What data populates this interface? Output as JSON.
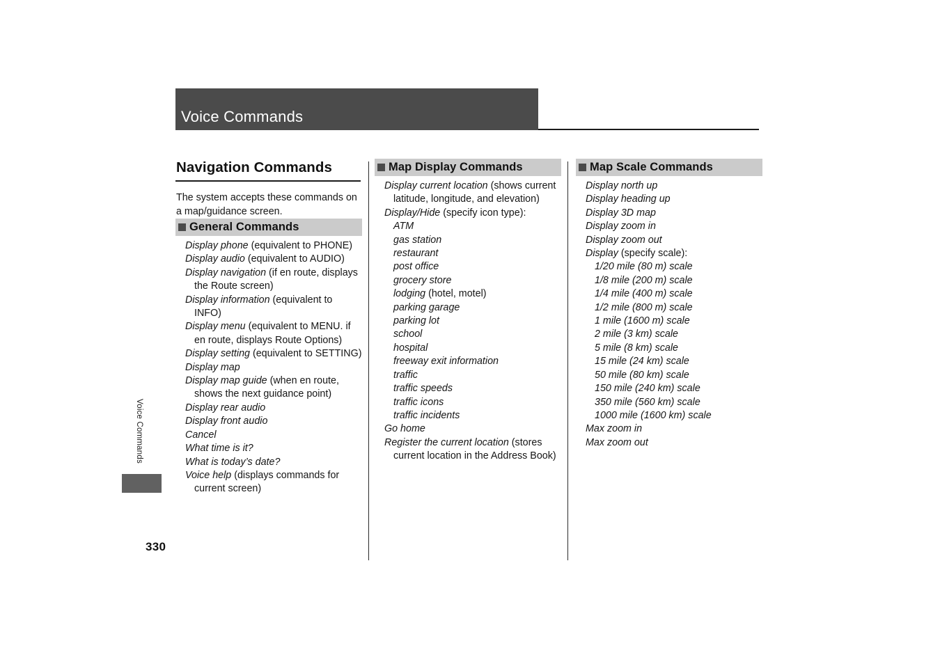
{
  "header": {
    "title": "Voice Commands",
    "bar_color": "#4b4b4b"
  },
  "side_tab": {
    "label": "Voice Commands",
    "block_color": "#616161"
  },
  "page_number": "330",
  "columns": {
    "left": {
      "title": "Navigation Commands",
      "intro": "The system accepts these commands on a map/guidance screen.",
      "section": {
        "label": "General Commands",
        "bullet_color": "#4b4b4b",
        "band_color": "#cbcbcb"
      },
      "items": [
        {
          "italic": "Display phone",
          "roman": " (equivalent to PHONE)"
        },
        {
          "italic": "Display audio",
          "roman": " (equivalent to AUDIO)"
        },
        {
          "italic": "Display navigation",
          "roman": " (if en route, displays the Route screen)"
        },
        {
          "italic": "Display information",
          "roman": " (equivalent to INFO)"
        },
        {
          "italic": "Display menu",
          "roman": " (equivalent to MENU. if en route, displays Route Options)"
        },
        {
          "italic": "Display setting",
          "roman": " (equivalent to SETTING)"
        },
        {
          "italic": "Display map",
          "roman": ""
        },
        {
          "italic": "Display map guide",
          "roman": " (when en route, shows the next guidance point)"
        },
        {
          "italic": "Display rear audio",
          "roman": ""
        },
        {
          "italic": "Display front audio",
          "roman": ""
        },
        {
          "italic": "Cancel",
          "roman": ""
        },
        {
          "italic": "What time is it?",
          "roman": ""
        },
        {
          "italic": "What is today’s date?",
          "roman": ""
        },
        {
          "italic": "Voice help",
          "roman": " (displays commands for current screen)"
        }
      ]
    },
    "middle": {
      "section": {
        "label": "Map Display Commands",
        "bullet_color": "#4b4b4b",
        "band_color": "#cbcbcb"
      },
      "items": [
        {
          "italic": "Display current location",
          "roman": " (shows current latitude, longitude, and elevation)",
          "sub": false
        },
        {
          "italic": "Display/Hide",
          "roman": " (specify icon type):",
          "sub": false
        },
        {
          "italic": "ATM",
          "roman": "",
          "sub": true
        },
        {
          "italic": "gas station",
          "roman": "",
          "sub": true
        },
        {
          "italic": "restaurant",
          "roman": "",
          "sub": true
        },
        {
          "italic": "post office",
          "roman": "",
          "sub": true
        },
        {
          "italic": "grocery store",
          "roman": "",
          "sub": true
        },
        {
          "italic": "lodging",
          "roman": " (hotel, motel)",
          "sub": true
        },
        {
          "italic": "parking garage",
          "roman": "",
          "sub": true
        },
        {
          "italic": "parking lot",
          "roman": "",
          "sub": true
        },
        {
          "italic": "school",
          "roman": "",
          "sub": true
        },
        {
          "italic": "hospital",
          "roman": "",
          "sub": true
        },
        {
          "italic": "freeway exit information",
          "roman": "",
          "sub": true
        },
        {
          "italic": "traffic",
          "roman": "",
          "sub": true
        },
        {
          "italic": "traffic speeds",
          "roman": "",
          "sub": true
        },
        {
          "italic": "traffic icons",
          "roman": "",
          "sub": true
        },
        {
          "italic": "traffic incidents",
          "roman": "",
          "sub": true
        },
        {
          "italic": "Go home",
          "roman": "",
          "sub": false
        },
        {
          "italic": "Register the current location",
          "roman": " (stores current location in the Address Book)",
          "sub": false
        }
      ]
    },
    "right": {
      "section": {
        "label": "Map Scale Commands",
        "bullet_color": "#4b4b4b",
        "band_color": "#cbcbcb"
      },
      "items": [
        {
          "italic": "Display north up",
          "roman": "",
          "sub": false
        },
        {
          "italic": "Display heading up",
          "roman": "",
          "sub": false
        },
        {
          "italic": "Display 3D map",
          "roman": "",
          "sub": false
        },
        {
          "italic": "Display zoom in",
          "roman": "",
          "sub": false
        },
        {
          "italic": "Display zoom out",
          "roman": "",
          "sub": false
        },
        {
          "italic": "Display",
          "roman": " (specify scale):",
          "sub": false
        },
        {
          "italic": "1/20 mile (80 m) scale",
          "roman": "",
          "sub": true
        },
        {
          "italic": "1/8 mile (200 m) scale",
          "roman": "",
          "sub": true
        },
        {
          "italic": "1/4 mile (400 m) scale",
          "roman": "",
          "sub": true
        },
        {
          "italic": "1/2 mile (800 m) scale",
          "roman": "",
          "sub": true
        },
        {
          "italic": "1 mile (1600 m) scale",
          "roman": "",
          "sub": true
        },
        {
          "italic": "2 mile (3 km) scale",
          "roman": "",
          "sub": true
        },
        {
          "italic": "5 mile (8 km) scale",
          "roman": "",
          "sub": true
        },
        {
          "italic": "15 mile (24 km) scale",
          "roman": "",
          "sub": true
        },
        {
          "italic": "50 mile (80 km) scale",
          "roman": "",
          "sub": true
        },
        {
          "italic": "150 mile (240 km) scale",
          "roman": "",
          "sub": true
        },
        {
          "italic": "350 mile (560 km) scale",
          "roman": "",
          "sub": true
        },
        {
          "italic": "1000 mile (1600 km) scale",
          "roman": "",
          "sub": true
        },
        {
          "italic": "Max zoom in",
          "roman": "",
          "sub": false
        },
        {
          "italic": "Max zoom out",
          "roman": "",
          "sub": false
        }
      ]
    }
  }
}
